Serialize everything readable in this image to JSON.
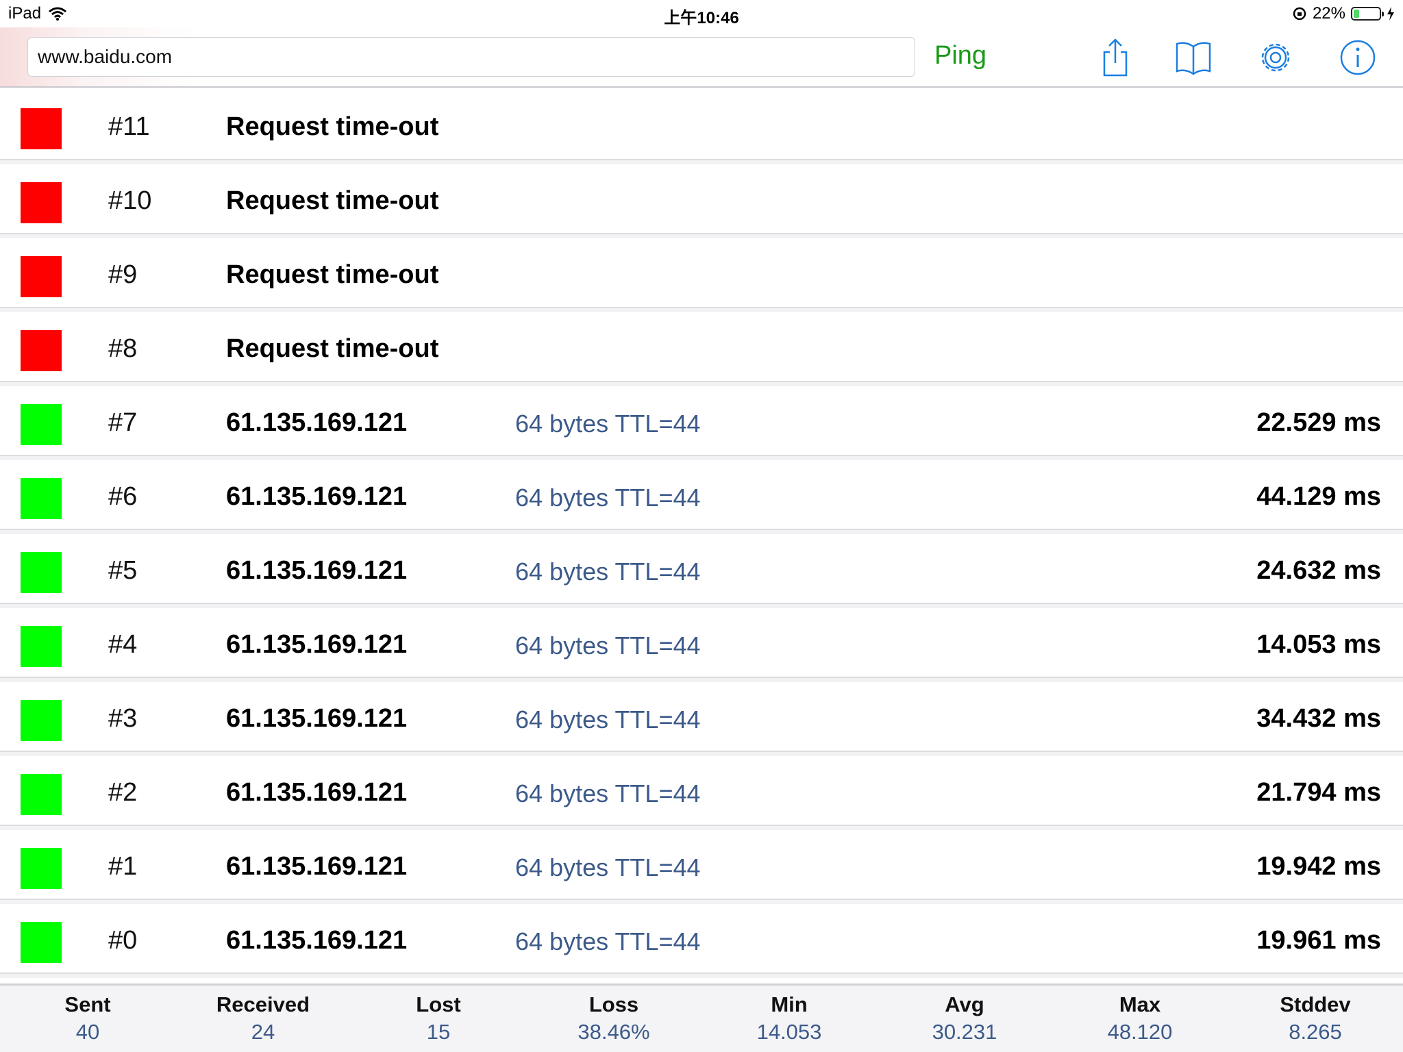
{
  "status_bar": {
    "device": "iPad",
    "time": "上午10:46",
    "battery": "22%",
    "battery_level": 0.22
  },
  "toolbar": {
    "url_value": "www.baidu.com",
    "ping_label": "Ping",
    "icons": [
      "share-icon",
      "bookmarks-icon",
      "gear-icon",
      "info-icon"
    ]
  },
  "colors": {
    "timeout": "#ff0000",
    "success": "#00ff00",
    "ping_green": "#1a9a1a",
    "detail_blue": "#3c5a8a",
    "ios_blue": "#1a7ee0"
  },
  "rows": [
    {
      "status": "timeout",
      "index": "#11",
      "address": "Request time-out",
      "detail": "",
      "time": ""
    },
    {
      "status": "timeout",
      "index": "#10",
      "address": "Request time-out",
      "detail": "",
      "time": ""
    },
    {
      "status": "timeout",
      "index": "#9",
      "address": "Request time-out",
      "detail": "",
      "time": ""
    },
    {
      "status": "timeout",
      "index": "#8",
      "address": "Request time-out",
      "detail": "",
      "time": ""
    },
    {
      "status": "success",
      "index": "#7",
      "address": "61.135.169.121",
      "detail": "64 bytes TTL=44",
      "time": "22.529 ms"
    },
    {
      "status": "success",
      "index": "#6",
      "address": "61.135.169.121",
      "detail": "64 bytes TTL=44",
      "time": "44.129 ms"
    },
    {
      "status": "success",
      "index": "#5",
      "address": "61.135.169.121",
      "detail": "64 bytes TTL=44",
      "time": "24.632 ms"
    },
    {
      "status": "success",
      "index": "#4",
      "address": "61.135.169.121",
      "detail": "64 bytes TTL=44",
      "time": "14.053 ms"
    },
    {
      "status": "success",
      "index": "#3",
      "address": "61.135.169.121",
      "detail": "64 bytes TTL=44",
      "time": "34.432 ms"
    },
    {
      "status": "success",
      "index": "#2",
      "address": "61.135.169.121",
      "detail": "64 bytes TTL=44",
      "time": "21.794 ms"
    },
    {
      "status": "success",
      "index": "#1",
      "address": "61.135.169.121",
      "detail": "64 bytes TTL=44",
      "time": "19.942 ms"
    },
    {
      "status": "success",
      "index": "#0",
      "address": "61.135.169.121",
      "detail": "64 bytes TTL=44",
      "time": "19.961 ms"
    }
  ],
  "stats": [
    {
      "label": "Sent",
      "value": "40"
    },
    {
      "label": "Received",
      "value": "24"
    },
    {
      "label": "Lost",
      "value": "15"
    },
    {
      "label": "Loss",
      "value": "38.46%"
    },
    {
      "label": "Min",
      "value": "14.053"
    },
    {
      "label": "Avg",
      "value": "30.231"
    },
    {
      "label": "Max",
      "value": "48.120"
    },
    {
      "label": "Stddev",
      "value": "8.265"
    }
  ]
}
